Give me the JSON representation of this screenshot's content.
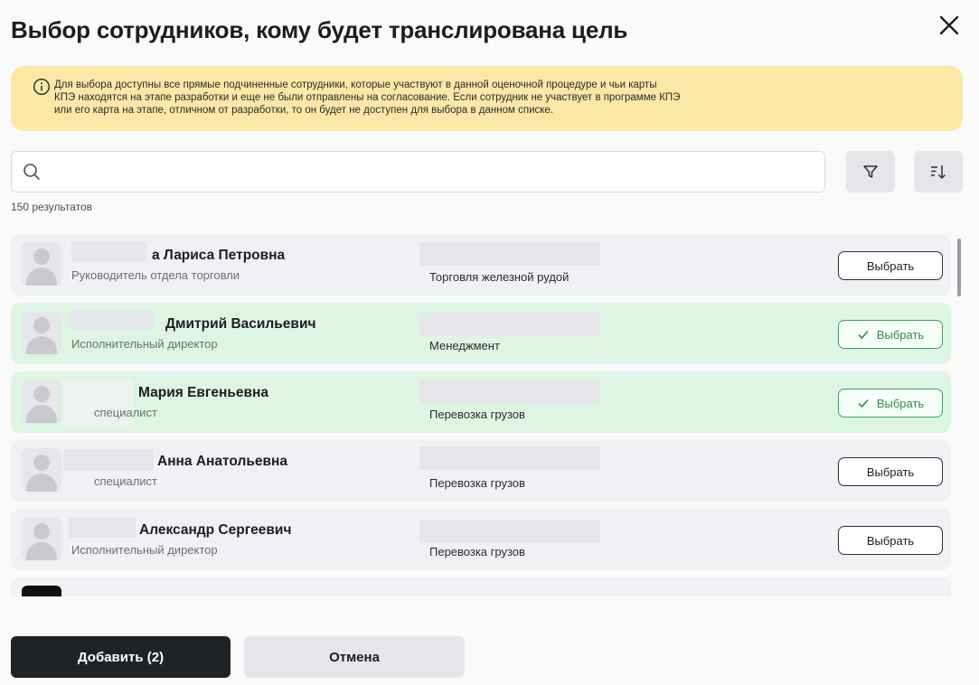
{
  "dialog": {
    "title": "Выбор сотрудников, кому будет транслирована цель",
    "notice": [
      "Для выбора доступны все прямые подчиненные сотрудники, которые участвуют в данной оценочной процедуре и чьи карты",
      "КПЭ находятся на этапе разработки и еще не были отправлены на согласование. Если сотрудник не участвует в программе КПЭ",
      "или его карта на этапе, отличном от разработки, то он будет не доступен для выбора в данном списке."
    ]
  },
  "search": {
    "placeholder": "",
    "value": ""
  },
  "results_count": "150 результатов",
  "employees": [
    {
      "name": "а Лариса Петровна",
      "role": "Руководитель отдела торговли",
      "department": "Торговля железной рудой",
      "selected": false,
      "button": "Выбрать"
    },
    {
      "name": "Дмитрий Васильевич",
      "role": "Исполнительный директор",
      "department": "Менеджмент",
      "selected": true,
      "button": "Выбрать"
    },
    {
      "name": "Мария Евгеньевна",
      "role": "специалист",
      "department": "Перевозка грузов",
      "selected": true,
      "button": "Выбрать"
    },
    {
      "name": "Анна Анатольевна",
      "role": "специалист",
      "department": "Перевозка грузов",
      "selected": false,
      "button": "Выбрать"
    },
    {
      "name": "Александр Сергеевич",
      "role": "Исполнительный директор",
      "department": "Перевозка грузов",
      "selected": false,
      "button": "Выбрать"
    }
  ],
  "footer": {
    "add_label": "Добавить (2)",
    "cancel_label": "Отмена"
  },
  "colors": {
    "notice_bg": "#fbe8a6",
    "selected_row_bg": "#ddf5e3",
    "selected_accent": "#3aa65a",
    "primary_button": "#1f2226"
  },
  "icons": [
    "close-icon",
    "info-icon",
    "search-icon",
    "filter-icon",
    "sort-icon",
    "check-icon",
    "avatar-placeholder-icon"
  ]
}
